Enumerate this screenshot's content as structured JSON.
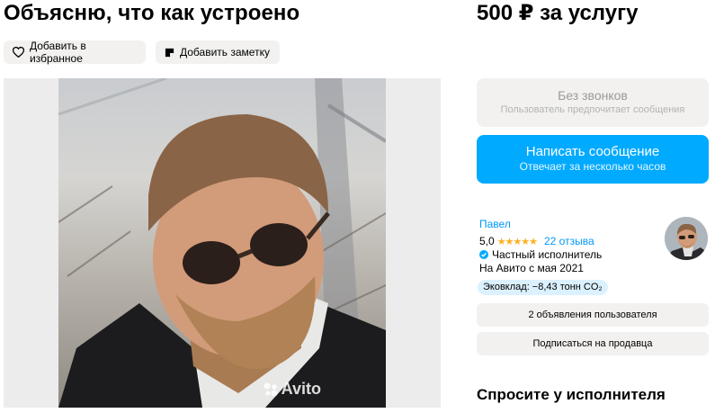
{
  "listing": {
    "title": "Объясню, что как устроено",
    "price": "500 ₽ за услугу"
  },
  "actions": {
    "favorite_label": "Добавить в избранное",
    "note_label": "Добавить заметку"
  },
  "gallery": {
    "watermark": "Avito"
  },
  "contact": {
    "no_calls_title": "Без звонков",
    "no_calls_subtitle": "Пользователь предпочитает сообщения",
    "message_title": "Написать сообщение",
    "message_subtitle": "Отвечает за несколько часов"
  },
  "seller": {
    "name": "Павел",
    "rating": "5,0",
    "stars": "★★★★★",
    "reviews": "22 отзыва",
    "type": "Частный исполнитель",
    "since": "На Авито с мая 2021",
    "eco": "Эковклад: −8,43 тонн CO₂"
  },
  "seller_actions": {
    "ads_label": "2 объявления пользователя",
    "subscribe_label": "Подписаться на продавца"
  },
  "ask": {
    "heading": "Спросите у исполнителя"
  },
  "colors": {
    "accent": "#00aaff",
    "link": "#0099f7",
    "star": "#ffb021",
    "chip_bg": "#f2f1f0",
    "eco_bg": "#dcf1ff"
  }
}
